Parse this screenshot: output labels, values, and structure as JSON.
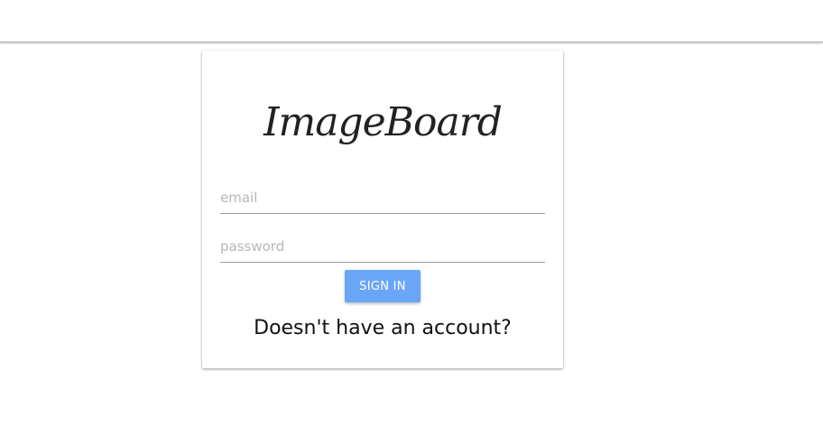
{
  "header": {},
  "login": {
    "logo_text": "ImageBoard",
    "email_placeholder": "email",
    "password_placeholder": "password",
    "email_value": "",
    "password_value": "",
    "signin_label": "SIGN IN",
    "signup_prompt": "Doesn't have an account?"
  },
  "colors": {
    "button": "#6aa6f8",
    "button_text": "#ffffff",
    "underline": "#9e9e9e",
    "placeholder": "#b6b6b6"
  }
}
